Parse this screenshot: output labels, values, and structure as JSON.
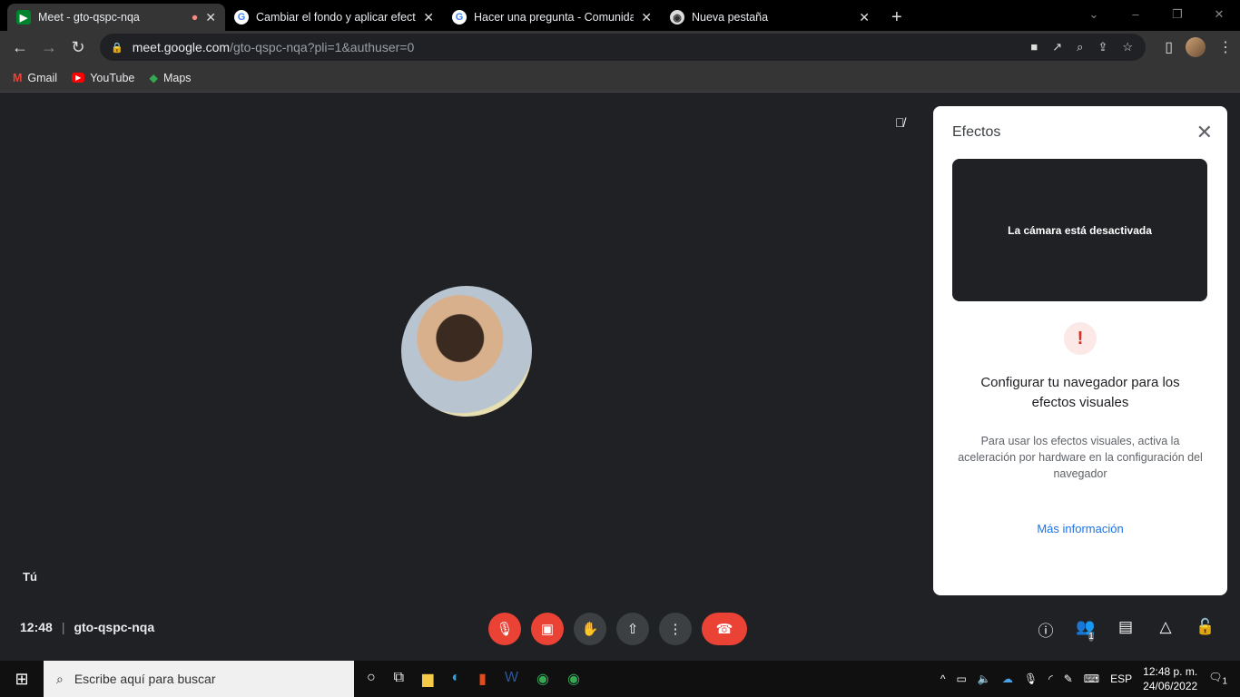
{
  "browser": {
    "tabs": [
      {
        "title": "Meet - gto-qspc-nqa",
        "active": true
      },
      {
        "title": "Cambiar el fondo y aplicar efectos"
      },
      {
        "title": "Hacer una pregunta - Comunidad"
      },
      {
        "title": "Nueva pestaña"
      }
    ],
    "url_host": "meet.google.com",
    "url_path": "/gto-qspc-nqa?pli=1&authuser=0",
    "bookmarks": [
      "Gmail",
      "YouTube",
      "Maps"
    ]
  },
  "meet": {
    "self_label": "Tú",
    "time": "12:48",
    "code": "gto-qspc-nqa",
    "participants_count": "1"
  },
  "panel": {
    "title": "Efectos",
    "camera_off": "La cámara está desactivada",
    "heading": "Configurar tu navegador para los efectos visuales",
    "description": "Para usar los efectos visuales, activa la aceleración por hardware en la configuración del navegador",
    "link": "Más información"
  },
  "taskbar": {
    "search_placeholder": "Escribe aquí para buscar",
    "lang": "ESP",
    "time": "12:48 p. m.",
    "date": "24/06/2022",
    "notifications": "1"
  },
  "colors": {
    "danger": "#ea4335",
    "link": "#1a73e8"
  }
}
